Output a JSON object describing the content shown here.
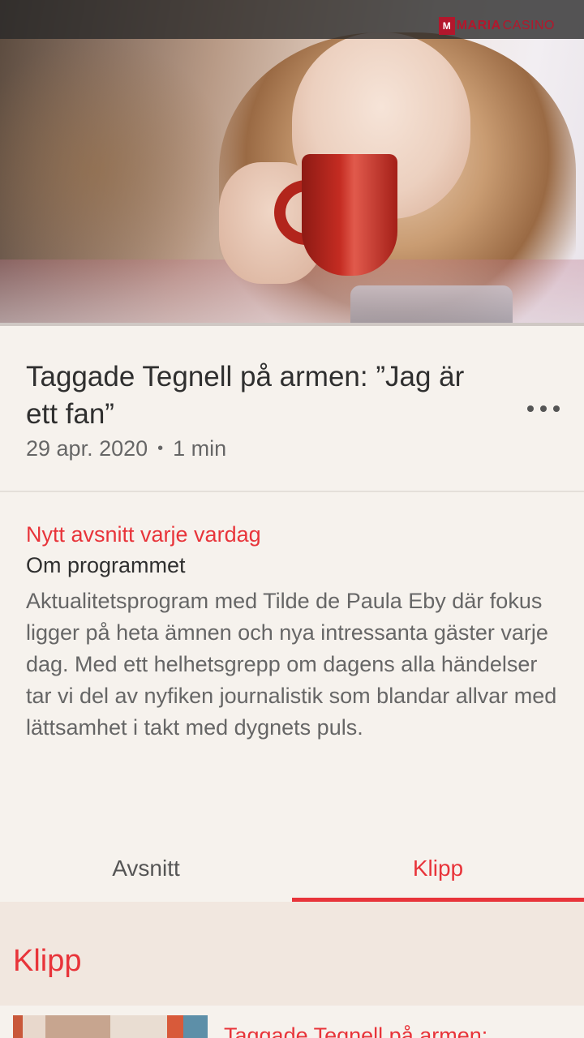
{
  "brand": {
    "logo_mark": "M",
    "logo_text_bold": "MARIA",
    "logo_text": "CASINO",
    "accent": "#e8343a"
  },
  "episode": {
    "title": "Taggade Tegnell på armen: ”Jag är ett fan”",
    "date": "29 apr. 2020",
    "separator": "•",
    "duration": "1 min",
    "more_icon": "more-horizontal-icon"
  },
  "about": {
    "tagline": "Nytt avsnitt varje vardag",
    "heading": "Om programmet",
    "description": "Aktualitetsprogram med Tilde de Paula Eby där fokus ligger på heta ämnen och nya intressanta gäster varje dag. Med ett helhetsgrepp om dagens alla händelser tar vi del av nyfiken journalistik som blandar allvar med lättsamhet i takt med dygnets puls."
  },
  "tabs": [
    {
      "label": "Avsnitt",
      "active": false
    },
    {
      "label": "Klipp",
      "active": true
    }
  ],
  "clips": {
    "section_title": "Klipp",
    "items": [
      {
        "title": "Taggade Tegnell på armen:"
      }
    ]
  }
}
